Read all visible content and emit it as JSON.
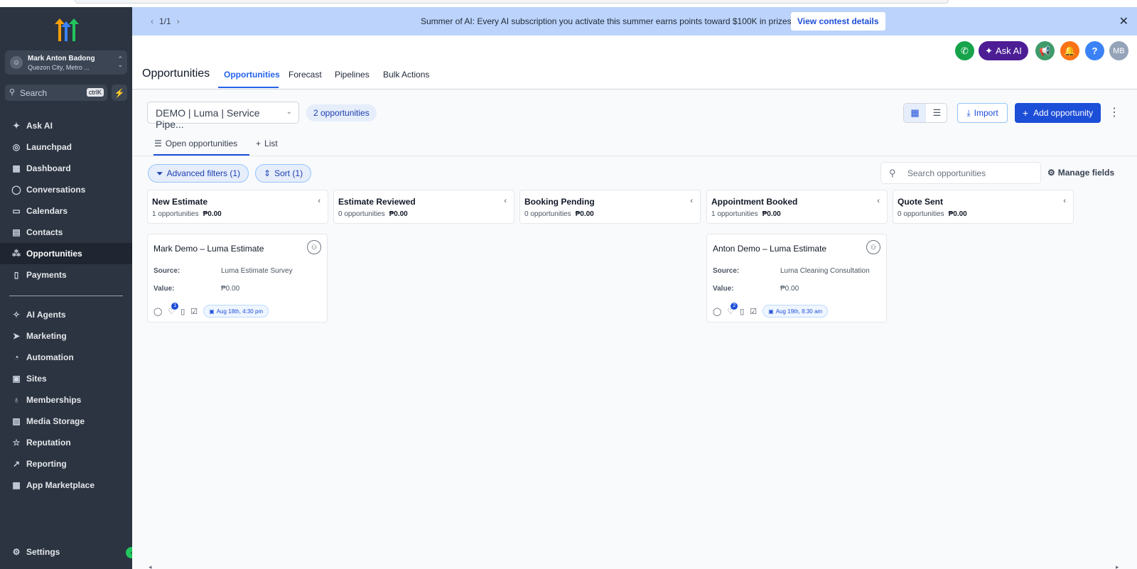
{
  "banner": {
    "pager": "1/1",
    "message": "Summer of AI: Every AI subscription you activate this summer earns points toward $100K in prizes.",
    "cta": "View contest details"
  },
  "account": {
    "name": "Mark Anton Badong",
    "location": "Quezon City, Metro ..."
  },
  "sidebar": {
    "search_placeholder": "Search",
    "search_shortcut": "ctrlK",
    "items": [
      {
        "label": "Ask AI",
        "icon": "sparkle-icon"
      },
      {
        "label": "Launchpad",
        "icon": "rocket-icon"
      },
      {
        "label": "Dashboard",
        "icon": "grid-icon"
      },
      {
        "label": "Conversations",
        "icon": "chat-icon"
      },
      {
        "label": "Calendars",
        "icon": "calendar-icon"
      },
      {
        "label": "Contacts",
        "icon": "contacts-icon"
      },
      {
        "label": "Opportunities",
        "icon": "opportunities-icon"
      },
      {
        "label": "Payments",
        "icon": "payments-icon"
      },
      {
        "label": "AI Agents",
        "icon": "ai-agents-icon"
      },
      {
        "label": "Marketing",
        "icon": "send-icon"
      },
      {
        "label": "Automation",
        "icon": "automation-icon"
      },
      {
        "label": "Sites",
        "icon": "sites-icon"
      },
      {
        "label": "Memberships",
        "icon": "award-icon"
      },
      {
        "label": "Media Storage",
        "icon": "image-icon"
      },
      {
        "label": "Reputation",
        "icon": "star-icon"
      },
      {
        "label": "Reporting",
        "icon": "trend-icon"
      },
      {
        "label": "App Marketplace",
        "icon": "apps-icon"
      }
    ],
    "settings": "Settings"
  },
  "header": {
    "title": "Opportunities",
    "ask_ai": "Ask AI",
    "user_initials": "MB",
    "tabs": [
      "Opportunities",
      "Forecast",
      "Pipelines",
      "Bulk Actions"
    ]
  },
  "toolbar": {
    "pipeline": "DEMO | Luma | Service Pipe...",
    "count": "2 opportunities",
    "import": "Import",
    "add": "Add opportunity"
  },
  "subtabs": {
    "open": "Open opportunities",
    "list": "List"
  },
  "filters": {
    "advanced": "Advanced filters (1)",
    "sort": "Sort (1)",
    "search_placeholder": "Search opportunities",
    "manage": "Manage fields"
  },
  "columns": [
    {
      "title": "New Estimate",
      "count": "1 opportunities",
      "amount": "₱0.00"
    },
    {
      "title": "Estimate Reviewed",
      "count": "0 opportunities",
      "amount": "₱0.00"
    },
    {
      "title": "Booking Pending",
      "count": "0 opportunities",
      "amount": "₱0.00"
    },
    {
      "title": "Appointment Booked",
      "count": "1 opportunities",
      "amount": "₱0.00"
    },
    {
      "title": "Quote Sent",
      "count": "0 opportunities",
      "amount": "₱0.00"
    }
  ],
  "cards": [
    {
      "title": "Mark Demo – Luma Estimate",
      "source_label": "Source:",
      "source": "Luma Estimate Survey",
      "value_label": "Value:",
      "value": "₱0.00",
      "badge": "1",
      "date": "Aug 18th, 4:30 pm"
    },
    {
      "title": "Anton Demo – Luma Estimate",
      "source_label": "Source:",
      "source": "Luma Cleaning Consultation",
      "value_label": "Value:",
      "value": "₱0.00",
      "badge": "2",
      "date": "Aug 19th, 8:30 am"
    }
  ],
  "colors": {
    "sidebar": "#2b3440",
    "primary": "#1d4ed8",
    "banner": "#bcd3fb",
    "phone": "#16a34a",
    "askai": "#4c1d95",
    "megaphone": "#3f9b6a",
    "bell": "#f97316",
    "help": "#3b82f6",
    "avatar": "#94a3b8"
  }
}
